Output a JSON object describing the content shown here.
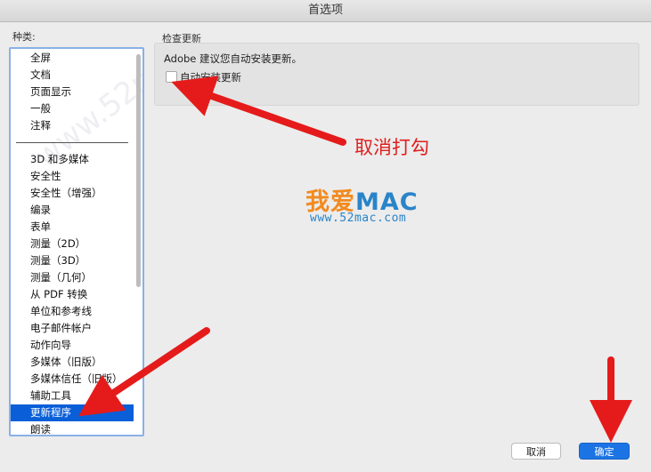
{
  "window": {
    "title": "首选项"
  },
  "categories": {
    "label": "种类:",
    "group1": [
      "全屏",
      "文档",
      "页面显示",
      "一般",
      "注释"
    ],
    "group2": [
      "3D 和多媒体",
      "安全性",
      "安全性（增强）",
      "编录",
      "表单",
      "测量（2D）",
      "测量（3D）",
      "测量（几何）",
      "从 PDF 转换",
      "单位和参考线",
      "电子邮件帐户",
      "动作向导",
      "多媒体（旧版）",
      "多媒体信任（旧版）",
      "辅助工具",
      "更新程序",
      "朗读"
    ],
    "selected": "更新程序"
  },
  "panel": {
    "title": "检查更新",
    "description": "Adobe 建议您自动安装更新。",
    "checkbox_label": "自动安装更新",
    "checkbox_checked": false
  },
  "annotation": {
    "text": "取消打勾",
    "color": "#e01e1e"
  },
  "watermark": {
    "logo_part1": "我爱",
    "logo_part2": "MAC",
    "url": "www.52mac.com",
    "diagonal": "www.52mac.com"
  },
  "buttons": {
    "cancel": "取消",
    "ok": "确定"
  },
  "colors": {
    "accent": "#1c74e4",
    "selection": "#0a5fd8",
    "logo_orange": "#f28a1e",
    "logo_blue": "#2a84c8"
  }
}
